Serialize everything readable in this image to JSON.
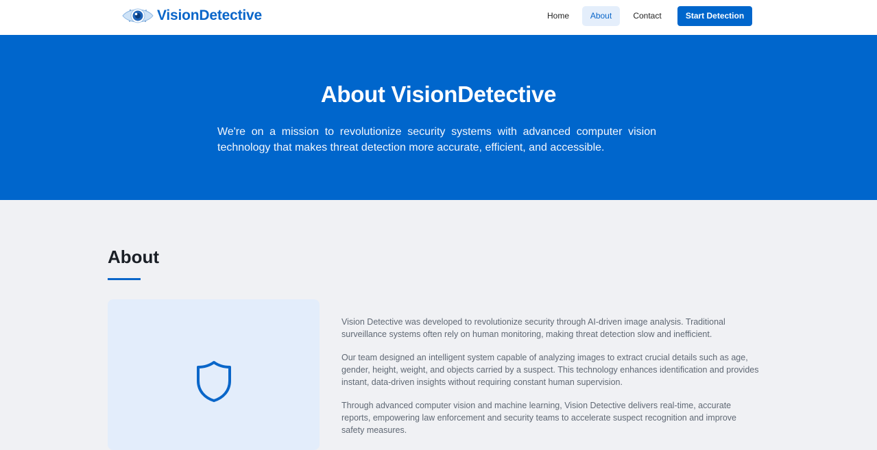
{
  "brand": {
    "name": "VisionDetective",
    "logo_icon": "eye-logo-icon"
  },
  "nav": {
    "home": "Home",
    "about": "About",
    "contact": "Contact",
    "cta": "Start Detection",
    "active": "About"
  },
  "hero": {
    "title": "About VisionDetective",
    "text": "We're on a mission to revolutionize security systems with advanced computer vision technology that makes threat detection more accurate, efficient, and accessible."
  },
  "about": {
    "title": "About",
    "icon": "shield-icon",
    "paragraphs": [
      "Vision Detective was developed to revolutionize security through AI-driven image analysis. Traditional surveillance systems often rely on human monitoring, making threat detection slow and inefficient.",
      "Our team designed an intelligent system capable of analyzing images to extract crucial details such as age, gender, height, weight, and objects carried by a suspect. This technology enhances identification and provides instant, data-driven insights without requiring constant human supervision.",
      "Through advanced computer vision and machine learning, Vision Detective delivers real-time, accurate reports, empowering law enforcement and security teams to accelerate suspect recognition and improve safety measures."
    ]
  },
  "colors": {
    "primary": "#0066cc",
    "hero_bg": "#0066cc",
    "page_bg": "#f0f1f4",
    "card_bg": "#e3edfb",
    "nav_active_bg": "#e4eefb"
  }
}
